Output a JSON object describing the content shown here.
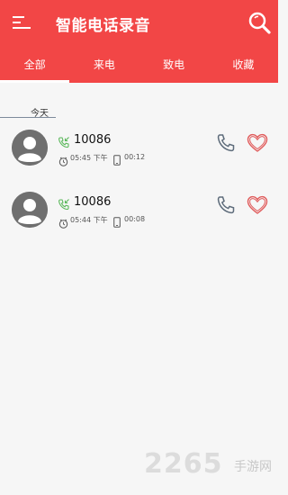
{
  "appbar": {
    "title": "智能电话录音",
    "menu_icon": "menu-icon",
    "search_icon": "search-icon"
  },
  "tabs": [
    {
      "label": "全部",
      "active": true
    },
    {
      "label": "来电",
      "active": false
    },
    {
      "label": "致电",
      "active": false
    },
    {
      "label": "收藏",
      "active": false
    }
  ],
  "section": {
    "label": "今天"
  },
  "calls": [
    {
      "number": "10086",
      "time": "05:45 下午",
      "duration": "00:12",
      "direction_icon": "incoming-call-icon"
    },
    {
      "number": "10086",
      "time": "05:44 下午",
      "duration": "00:08",
      "direction_icon": "incoming-call-icon"
    }
  ],
  "watermark": {
    "number": "2265",
    "text": "手游网"
  },
  "colors": {
    "primary": "#f24646",
    "incoming": "#5cb85c",
    "heart": "#e05a5a",
    "dial": "#5d6b7a"
  }
}
